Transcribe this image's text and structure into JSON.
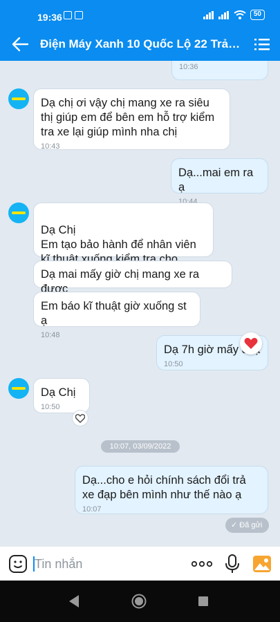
{
  "status": {
    "time": "19:36",
    "battery": "50"
  },
  "header": {
    "title": "Điện Máy Xanh 10 Quốc Lộ 22 Trảng..."
  },
  "messages": [
    {
      "time": "10:36"
    },
    {
      "text": "Dạ chị ơi vậy chị mang xe ra siêu thị giúp em để bên em hỗ trợ kiểm tra xe lại giúp mình nha chị",
      "time": "10:43"
    },
    {
      "text": "Dạ...mai em ra ạ",
      "time": "10:44"
    },
    {
      "text": "Dạ Chị\nEm tạo bảo hành để nhân viên kĩ thuật xuống kiểm tra cho mình"
    },
    {
      "text": "Dạ mai mấy giờ chị mang xe ra được"
    },
    {
      "text": "Em báo kĩ thuật giờ xuống st ạ",
      "time": "10:48"
    },
    {
      "text": "Dạ 7h giờ mấy đi ạ",
      "time": "10:50"
    },
    {
      "text": "Dạ Chị",
      "time": "10:50"
    },
    {
      "text": "Dạ...cho e hỏi chính sách đổi trả xe đạp bên mình như thế nào ạ",
      "time": "10:07"
    }
  ],
  "date_divider": "10:07, 03/09/2022",
  "sent_status": "Đã gửi",
  "input": {
    "placeholder": "Tin nhắn"
  },
  "colors": {
    "header": "#0a8cf0",
    "chat_bg": "#e2e9f1",
    "outgoing": "#e3f3ff",
    "incoming": "#ffffff",
    "heart": "#e8323c"
  }
}
